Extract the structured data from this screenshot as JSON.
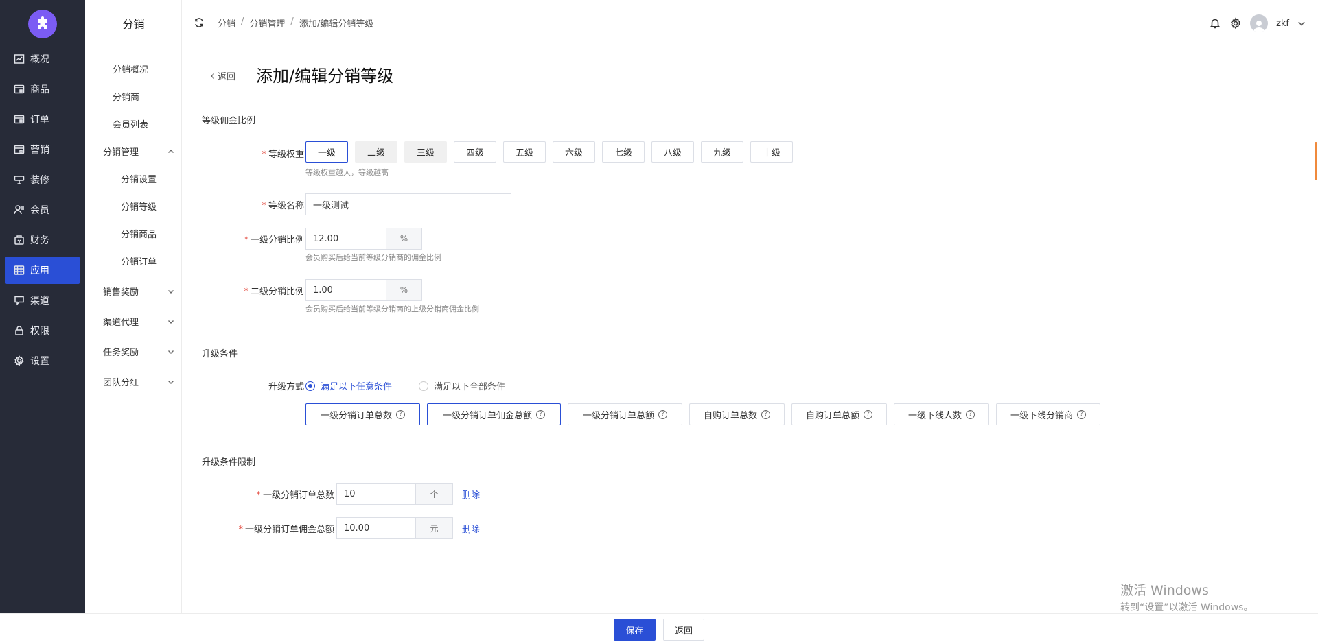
{
  "nav": {
    "items": [
      {
        "label": "概况",
        "icon": "chart-icon"
      },
      {
        "label": "商品",
        "icon": "goods-icon"
      },
      {
        "label": "订单",
        "icon": "order-icon"
      },
      {
        "label": "营销",
        "icon": "marketing-icon"
      },
      {
        "label": "装修",
        "icon": "decoration-icon"
      },
      {
        "label": "会员",
        "icon": "member-icon"
      },
      {
        "label": "财务",
        "icon": "finance-icon"
      },
      {
        "label": "应用",
        "icon": "apps-icon",
        "active": true
      },
      {
        "label": "渠道",
        "icon": "channel-icon"
      },
      {
        "label": "权限",
        "icon": "lock-icon"
      },
      {
        "label": "设置",
        "icon": "gear-icon"
      }
    ]
  },
  "subnav": {
    "title": "分销",
    "items": [
      "分销概况",
      "分销商",
      "会员列表"
    ],
    "group_manage": "分销管理",
    "manage_children": [
      "分销设置",
      "分销等级",
      "分销商品",
      "分销订单"
    ],
    "groups": [
      "销售奖励",
      "渠道代理",
      "任务奖励",
      "团队分红"
    ]
  },
  "header": {
    "breadcrumb": [
      "分销",
      "分销管理",
      "添加/编辑分销等级"
    ],
    "username": "zkf"
  },
  "page": {
    "back": "返回",
    "title": "添加/编辑分销等级"
  },
  "section_commission": {
    "title": "等级佣金比例",
    "weight_label": "等级权重",
    "levels": [
      "一级",
      "二级",
      "三级",
      "四级",
      "五级",
      "六级",
      "七级",
      "八级",
      "九级",
      "十级"
    ],
    "weight_hint": "等级权重越大，等级越高",
    "name_label": "等级名称",
    "name_value": "一级测试",
    "first_label": "一级分销比例",
    "first_value": "12.00",
    "first_unit": "%",
    "first_hint": "会员购买后给当前等级分销商的佣金比例",
    "second_label": "二级分销比例",
    "second_value": "1.00",
    "second_unit": "%",
    "second_hint": "会员购买后给当前等级分销商的上级分销商佣金比例"
  },
  "section_upgrade": {
    "title": "升级条件",
    "mode_label": "升级方式",
    "mode_any": "满足以下任意条件",
    "mode_all": "满足以下全部条件",
    "conditions": [
      "一级分销订单总数",
      "一级分销订单佣金总额",
      "一级分销订单总额",
      "自购订单总数",
      "自购订单总额",
      "一级下线人数",
      "一级下线分销商"
    ]
  },
  "section_limit": {
    "title": "升级条件限制",
    "rows": [
      {
        "label": "一级分销订单总数",
        "value": "10",
        "unit": "个",
        "action": "删除"
      },
      {
        "label": "一级分销订单佣金总额",
        "value": "10.00",
        "unit": "元",
        "action": "删除"
      }
    ]
  },
  "footer": {
    "save": "保存",
    "back": "返回"
  },
  "watermark": {
    "line1": "激活 Windows",
    "line2": "转到“设置”以激活 Windows。"
  },
  "colors": {
    "accent": "#2a4fd6",
    "nav_bg": "#272b38",
    "logo": "#7b5cf4",
    "required": "#e54d42",
    "scroll_thumb": "#f08a3c"
  }
}
